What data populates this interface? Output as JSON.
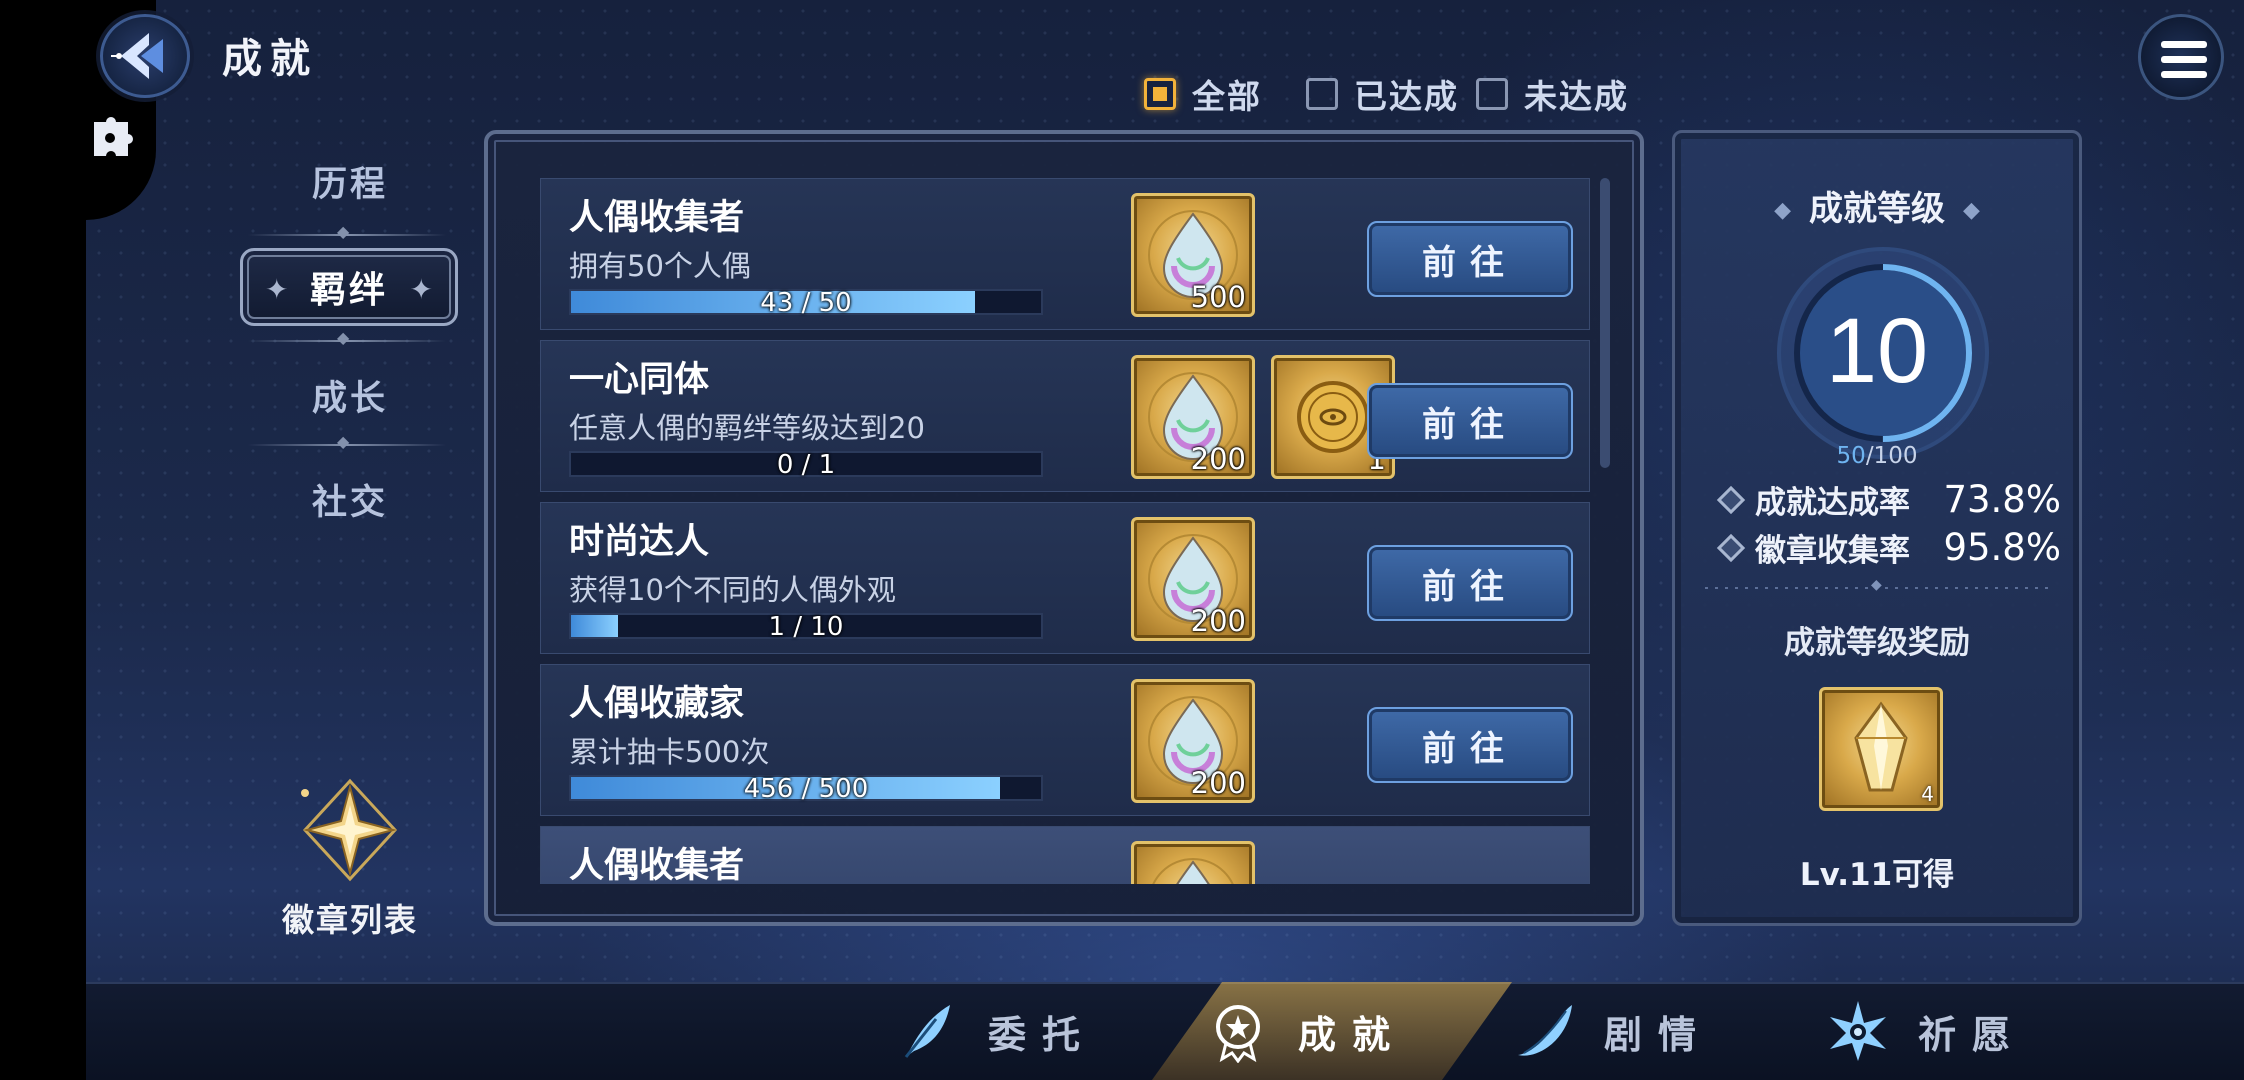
{
  "header": {
    "title": "成就"
  },
  "filters": [
    {
      "label": "全部",
      "checked": true
    },
    {
      "label": "已达成",
      "checked": false
    },
    {
      "label": "未达成",
      "checked": false
    }
  ],
  "nav": {
    "items": [
      "历程",
      "羁绊",
      "成长",
      "社交"
    ],
    "active": "羁绊",
    "badge_list_label": "徽章列表"
  },
  "achievements": [
    {
      "title": "人偶收集者",
      "desc": "拥有50个人偶",
      "progress_text": "43 / 50",
      "progress": 0.86,
      "rewards": [
        {
          "icon": "prism-drop-icon",
          "count": "500"
        }
      ],
      "button": "前往"
    },
    {
      "title": "一心同体",
      "desc": "任意人偶的羁绊等级达到20",
      "progress_text": "0 / 1",
      "progress": 0.0,
      "rewards": [
        {
          "icon": "prism-drop-icon",
          "count": "200"
        },
        {
          "icon": "gold-coin-icon",
          "count": "1"
        }
      ],
      "button": "前往"
    },
    {
      "title": "时尚达人",
      "desc": "获得10个不同的人偶外观",
      "progress_text": "1 / 10",
      "progress": 0.1,
      "rewards": [
        {
          "icon": "prism-drop-icon",
          "count": "200"
        }
      ],
      "button": "前往"
    },
    {
      "title": "人偶收藏家",
      "desc": "累计抽卡500次",
      "progress_text": "456 / 500",
      "progress": 0.912,
      "rewards": [
        {
          "icon": "prism-drop-icon",
          "count": "200"
        }
      ],
      "button": "前往"
    },
    {
      "title": "人偶收集者",
      "desc": "",
      "progress_text": "",
      "progress": 0,
      "rewards": [
        {
          "icon": "prism-drop-icon",
          "count": ""
        }
      ],
      "button": ""
    }
  ],
  "level_panel": {
    "title": "成就等级",
    "level": "10",
    "exp_current": "50",
    "exp_total": "/100",
    "exp_fraction": 0.5,
    "stats": [
      {
        "label": "成就达成率",
        "value": "73.8%"
      },
      {
        "label": "徽章收集率",
        "value": "95.8%"
      }
    ],
    "reward_title": "成就等级奖励",
    "reward_count": "4",
    "reward_unlock": "Lv.11可得"
  },
  "bottom_tabs": [
    {
      "label": "委托",
      "icon": "feather-icon",
      "active": false
    },
    {
      "label": "成就",
      "icon": "medal-icon",
      "active": true
    },
    {
      "label": "剧情",
      "icon": "quill-icon",
      "active": false
    },
    {
      "label": "祈愿",
      "icon": "star-burst-icon",
      "active": false
    }
  ],
  "colors": {
    "accent_gold": "#f2b23a",
    "progress_blue": "#8bd0ff",
    "button_blue": "#3f6aa8"
  }
}
